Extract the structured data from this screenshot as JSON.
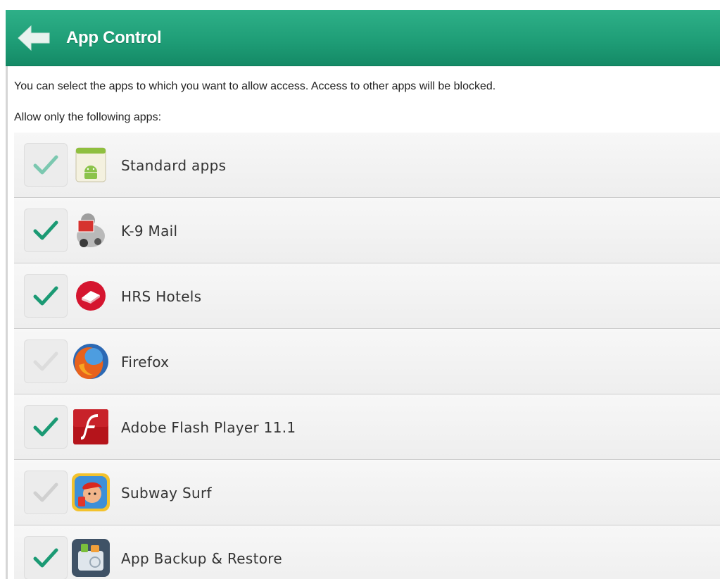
{
  "header": {
    "title": "App Control",
    "color": "#1f9e77"
  },
  "main": {
    "description": "You can select the apps to which you want to allow access. Access to other apps will be blocked.",
    "subheading": "Allow only the following apps:",
    "apps": [
      {
        "name": "Standard apps",
        "checked": true,
        "state": "partial",
        "icon": "android-icon"
      },
      {
        "name": "K-9 Mail",
        "checked": true,
        "state": "full",
        "icon": "k9-mail-icon"
      },
      {
        "name": "HRS Hotels",
        "checked": true,
        "state": "full",
        "icon": "hrs-hotels-icon"
      },
      {
        "name": "Firefox",
        "checked": false,
        "state": "none",
        "icon": "firefox-icon"
      },
      {
        "name": "Adobe Flash Player 11.1",
        "checked": true,
        "state": "full",
        "icon": "flash-player-icon"
      },
      {
        "name": "Subway Surf",
        "checked": false,
        "state": "none",
        "icon": "subway-surf-icon"
      },
      {
        "name": "App Backup & Restore",
        "checked": true,
        "state": "full",
        "icon": "app-backup-icon"
      }
    ]
  }
}
